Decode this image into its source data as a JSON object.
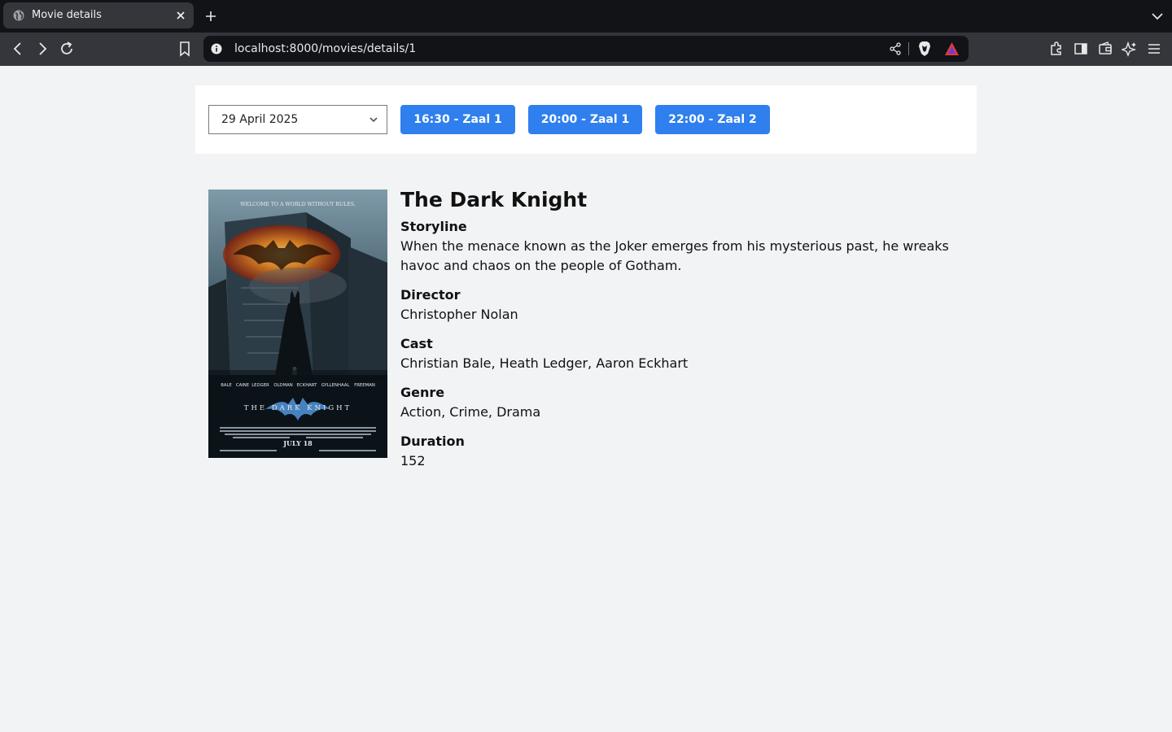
{
  "browser": {
    "tab_title": "Movie details",
    "url": "localhost:8000/movies/details/1"
  },
  "schedule": {
    "selected_date": "29 April 2025",
    "showtimes": [
      "16:30 - Zaal 1",
      "20:00 - Zaal 1",
      "22:00 - Zaal 2"
    ]
  },
  "poster": {
    "tagline": "WELCOME TO A WORLD WITHOUT RULES.",
    "credits": [
      "BALE",
      "CAINE",
      "LEDGER",
      "OLDMAN",
      "ECKHART",
      "GYLLENHAAL",
      "FREEMAN"
    ],
    "logo_text": "THE DARK KNIGHT",
    "release": "JULY 18"
  },
  "movie": {
    "title": "The Dark Knight",
    "storyline_label": "Storyline",
    "storyline": "When the menace known as the Joker emerges from his mysterious past, he wreaks havoc and chaos on the people of Gotham.",
    "director_label": "Director",
    "director": "Christopher Nolan",
    "cast_label": "Cast",
    "cast": "Christian Bale, Heath Ledger, Aaron Eckhart",
    "genre_label": "Genre",
    "genre": "Action, Crime, Drama",
    "duration_label": "Duration",
    "duration": "152"
  }
}
